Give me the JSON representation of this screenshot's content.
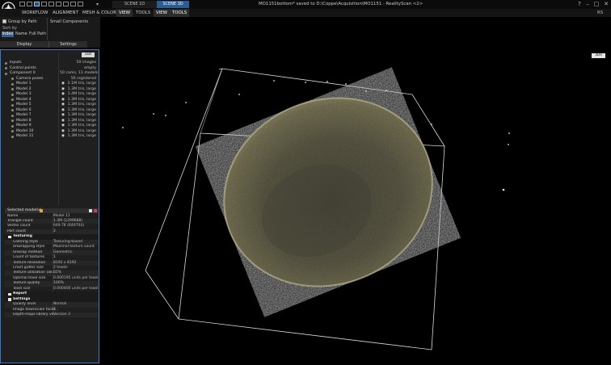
{
  "app": {
    "window_title": "MO1151bottom* saved to D:\\Coppe\\Acquisition\\MO1151 - RealityScan <2>",
    "tabs": [
      "SCENE 1D",
      "SCENE 3D"
    ],
    "right_label": "RS",
    "window_controls": [
      "?",
      "–",
      "□",
      "✕"
    ],
    "menu": [
      "WORKFLOW",
      "ALIGNMENT",
      "MESH & COLOR",
      "VIEW",
      "TOOLS",
      "VIEW",
      "TOOLS"
    ]
  },
  "ribbon": {
    "group_by_path": "Group by Path",
    "small_components": "Small Components",
    "sort_by": "Sort by",
    "sort_options": [
      "Index",
      "Name",
      "Full Path"
    ],
    "display": "Display",
    "settings": "Settings"
  },
  "tree": {
    "pin": "1Ds",
    "rows": [
      {
        "label": "Inputs",
        "value": "50 images",
        "level": 0
      },
      {
        "label": "Control points",
        "value": "empty",
        "level": 0
      },
      {
        "label": "Component 0",
        "value": "50 cams, 11 models",
        "level": 0
      },
      {
        "label": "Camera poses",
        "value": "50 registered",
        "level": 1
      },
      {
        "label": "Model 1",
        "value": "2.1M tris, large",
        "level": 1
      },
      {
        "label": "Model 2",
        "value": "1.3M tris, large",
        "level": 1
      },
      {
        "label": "Model 3",
        "value": "1.4M tris, large",
        "level": 1
      },
      {
        "label": "Model 4",
        "value": "1.3M tris, large",
        "level": 1
      },
      {
        "label": "Model 5",
        "value": "1.3M tris, large",
        "level": 1
      },
      {
        "label": "Model 6",
        "value": "1.3M tris, large",
        "level": 1
      },
      {
        "label": "Model 7",
        "value": "1.3M tris, large",
        "level": 1
      },
      {
        "label": "Model 8",
        "value": "1.3M tris, large",
        "level": 1
      },
      {
        "label": "Model 9",
        "value": "1.3M tris, large",
        "level": 1
      },
      {
        "label": "Model 10",
        "value": "1.3M tris, large",
        "level": 1
      },
      {
        "label": "Model 11",
        "value": "1.3M tris, large",
        "level": 1
      }
    ]
  },
  "selected": {
    "title": "Selected model(s)",
    "rows": [
      {
        "key": "Name",
        "value": "Model 11",
        "type": "row"
      },
      {
        "key": "Triangle count",
        "value": "1.3M (1299688)",
        "type": "row"
      },
      {
        "key": "Vertex count",
        "value": "649.7K (649704)",
        "type": "row"
      },
      {
        "key": "Part count",
        "value": "2",
        "type": "row"
      },
      {
        "key": "Texturing",
        "value": "",
        "type": "section"
      },
      {
        "key": "Coloring style",
        "value": "Texturing-based",
        "type": "indent"
      },
      {
        "key": "Unwrapping style",
        "value": "Maximal texture count",
        "type": "indent"
      },
      {
        "key": "Unwrap method",
        "value": "Geometric",
        "type": "indent"
      },
      {
        "key": "Count of textures",
        "value": "1",
        "type": "indent"
      },
      {
        "key": "Texture resolution",
        "value": "8192 x 8192",
        "type": "indent"
      },
      {
        "key": "Chart gutter size",
        "value": "2 texels",
        "type": "indent"
      },
      {
        "key": "Texture utilization (all...",
        "value": "65%",
        "type": "indent"
      },
      {
        "key": "Optimal texel size",
        "value": "0.000195 units per texel",
        "type": "indent"
      },
      {
        "key": "Texture quality",
        "value": "100%",
        "type": "indent"
      },
      {
        "key": "Texel size",
        "value": "0.000400 units per texel",
        "type": "indent"
      },
      {
        "key": "Report",
        "value": "",
        "type": "section"
      },
      {
        "key": "Settings",
        "value": "",
        "type": "section"
      },
      {
        "key": "Quality level",
        "value": "Normal",
        "type": "indent"
      },
      {
        "key": "Image downscale facto...",
        "value": "2",
        "type": "indent"
      },
      {
        "key": "Depth-maps library ve...",
        "value": "Version 3",
        "type": "indent"
      }
    ]
  },
  "viewport": {
    "pin": "3Ds",
    "colors": {
      "model": "#5f5c48",
      "bbox": "#d9d9d9",
      "background": "#000000"
    }
  }
}
